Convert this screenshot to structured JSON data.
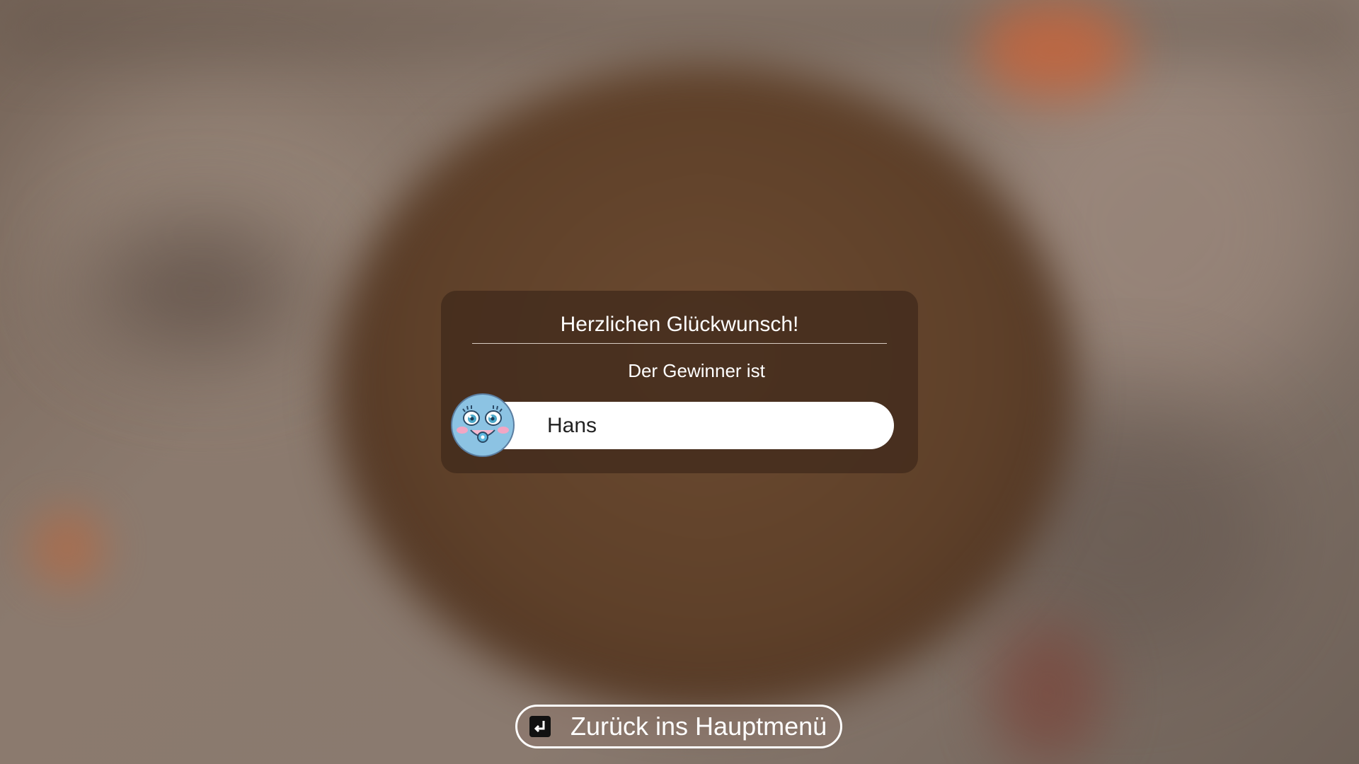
{
  "dialog": {
    "title": "Herzlichen Glückwunsch!",
    "subtitle": "Der Gewinner ist",
    "winner": {
      "name": "Hans",
      "avatar_icon": "blue-smiley-avatar-icon"
    }
  },
  "footer": {
    "back_button_label": "Zurück ins Hauptmenü",
    "back_button_icon": "enter-key-icon"
  }
}
